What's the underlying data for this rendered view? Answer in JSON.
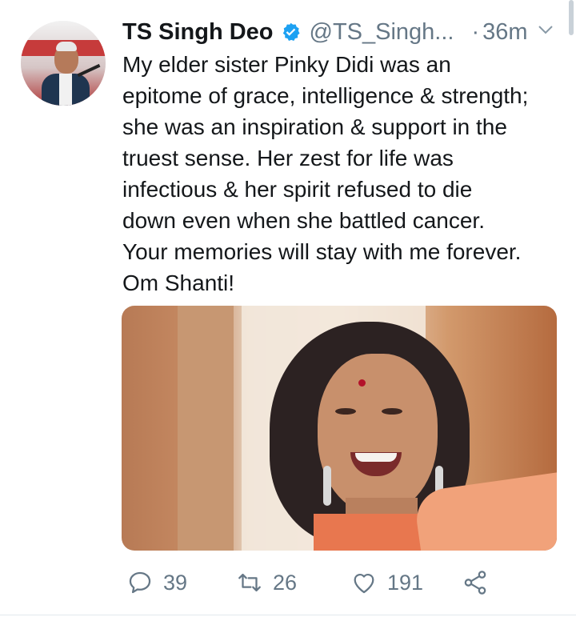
{
  "tweet": {
    "author_name": "TS Singh Deo",
    "handle": "@TS_Singh...",
    "separator": "·",
    "time": "36m",
    "text": "My elder sister Pinky Didi was an\nepitome of grace, intelligence & strength;\nshe was an inspiration & support in the\ntruest sense. Her zest for life was\ninfectious & her spirit refused to die\ndown even when she battled cancer.\nYour memories will stay with me forever.\nOm Shanti!"
  },
  "actions": {
    "reply_count": "39",
    "retweet_count": "26",
    "like_count": "191"
  },
  "icons": {
    "verified": "verified-badge-icon",
    "caret": "chevron-down-icon",
    "reply": "reply-icon",
    "retweet": "retweet-icon",
    "like": "heart-icon",
    "share": "share-icon"
  },
  "colors": {
    "accent": "#1da1f2",
    "muted": "#657786",
    "text": "#14171a"
  }
}
